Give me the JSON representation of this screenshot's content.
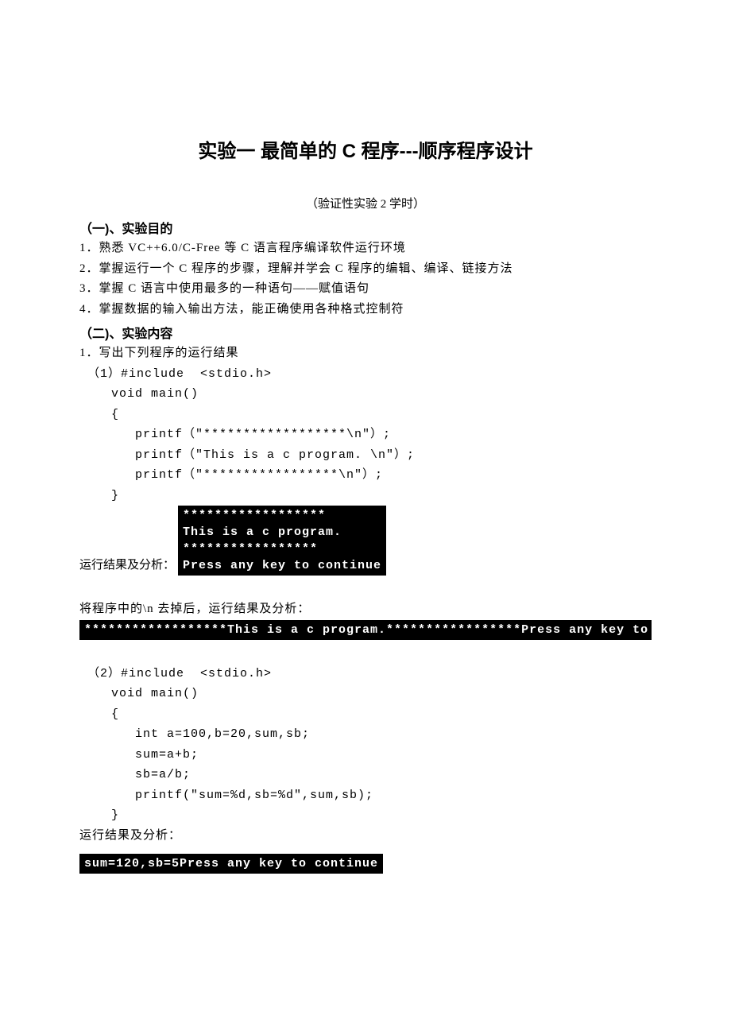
{
  "title": "实验一   最简单的 C 程序---顺序程序设计",
  "subline": "（验证性实验   2 学时）",
  "sec1_head": "（一)、实验目的",
  "goals": [
    "1．熟悉 VC++6.0/C-Free 等 C 语言程序编译软件运行环境",
    "2．掌握运行一个 C 程序的步骤，理解并学会 C 程序的编辑、编译、链接方法",
    "3．掌握 C 语言中使用最多的一种语句——赋值语句",
    "4．掌握数据的输入输出方法，能正确使用各种格式控制符"
  ],
  "sec2_head": "（二)、实验内容",
  "task_header": "1．写出下列程序的运行结果",
  "code1": {
    "l0": "（1）#include  <stdio.h>",
    "l1": "void main()",
    "l2": "{",
    "l3": "printf（\"******************\\n\"）;",
    "l4": "printf（\"This is a c program. \\n\"）;",
    "l5": "printf（\"*****************\\n\"）;",
    "l6": "}"
  },
  "result_label": "运行结果及分析：",
  "console1": "******************\nThis is a c program.\n*****************\nPress any key to continue",
  "remove_n_line": "将程序中的\\n 去掉后，运行结果及分析：",
  "console1b": "******************This is a c program.*****************Press any key to continue",
  "code2": {
    "l0": "（2）#include  <stdio.h>",
    "l1": "void main()",
    "l2": "{",
    "l3": "int a=100,b=20,sum,sb;",
    "l4": "sum=a+b;",
    "l5": "sb=a/b;",
    "l6": "printf(\"sum=%d,sb=%d\",sum,sb);",
    "l7": "}"
  },
  "result_label2": "运行结果及分析：",
  "console2": "sum=120,sb=5Press any key to continue"
}
